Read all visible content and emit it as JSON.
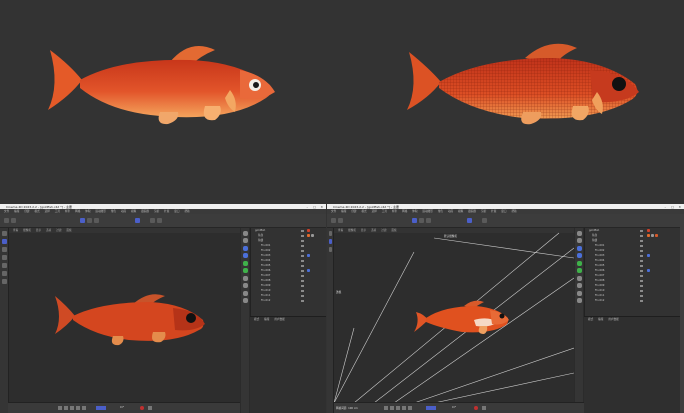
{
  "windows": [
    {
      "title": "Cinema 4D 2023.2.2 - [goldfish.c4d *] - 主要",
      "menu": [
        "文件",
        "编辑",
        "创建",
        "模式",
        "选择",
        "工具",
        "样条",
        "网格",
        "体积",
        "运动图形",
        "角色",
        "动画",
        "模拟",
        "跟踪器",
        "渲染",
        "扩展",
        "窗口",
        "帮助"
      ],
      "viewport_menu": [
        "查看",
        "摄像机",
        "显示",
        "选项",
        "过滤",
        "面板"
      ],
      "objects": [
        "goldfish",
        "鱼身",
        "鱼鳍",
        "Fin.001",
        "Fin.002",
        "Fin.003",
        "Fin.004",
        "Fin.005",
        "Fin.006",
        "Fin.007",
        "Fin.008",
        "Fin.009",
        "Fin.010",
        "Fin.011",
        "Fin.012"
      ],
      "attr_tabs": [
        "模式",
        "编辑",
        "用户数据"
      ],
      "frame": "0 F"
    },
    {
      "title": "Cinema 4D 2023.2.2 - [goldfish.c4d *] - 主要",
      "menu": [
        "文件",
        "编辑",
        "创建",
        "模式",
        "选择",
        "工具",
        "样条",
        "网格",
        "体积",
        "运动图形",
        "角色",
        "动画",
        "模拟",
        "跟踪器",
        "渲染",
        "扩展",
        "窗口",
        "帮助"
      ],
      "viewport_menu": [
        "查看",
        "摄像机",
        "显示",
        "选项",
        "过滤",
        "面板"
      ],
      "viewport_camera_label": "默认摄像机",
      "viewport_side_label": "透视",
      "status": "网格间距: 100 cm",
      "objects": [
        "goldfish",
        "鱼身",
        "鱼鳍",
        "Fin.001",
        "Fin.002",
        "Fin.003",
        "Fin.004",
        "Fin.005",
        "Fin.006",
        "Fin.007",
        "Fin.008",
        "Fin.009",
        "Fin.010",
        "Fin.011",
        "Fin.012"
      ],
      "attr_tabs": [
        "模式",
        "编辑",
        "用户数据"
      ],
      "frame": "0 F"
    }
  ],
  "icons": [
    "minimize-icon",
    "maximize-icon",
    "close-icon",
    "move-tool-icon",
    "rotate-tool-icon",
    "scale-tool-icon",
    "cube-icon",
    "render-icon",
    "play-icon",
    "record-icon"
  ],
  "colors": {
    "accent": "#4b5fc9",
    "fish_body": "#d8461e",
    "fish_belly": "#f2a05a",
    "window_bg": "#2b2b2b"
  }
}
